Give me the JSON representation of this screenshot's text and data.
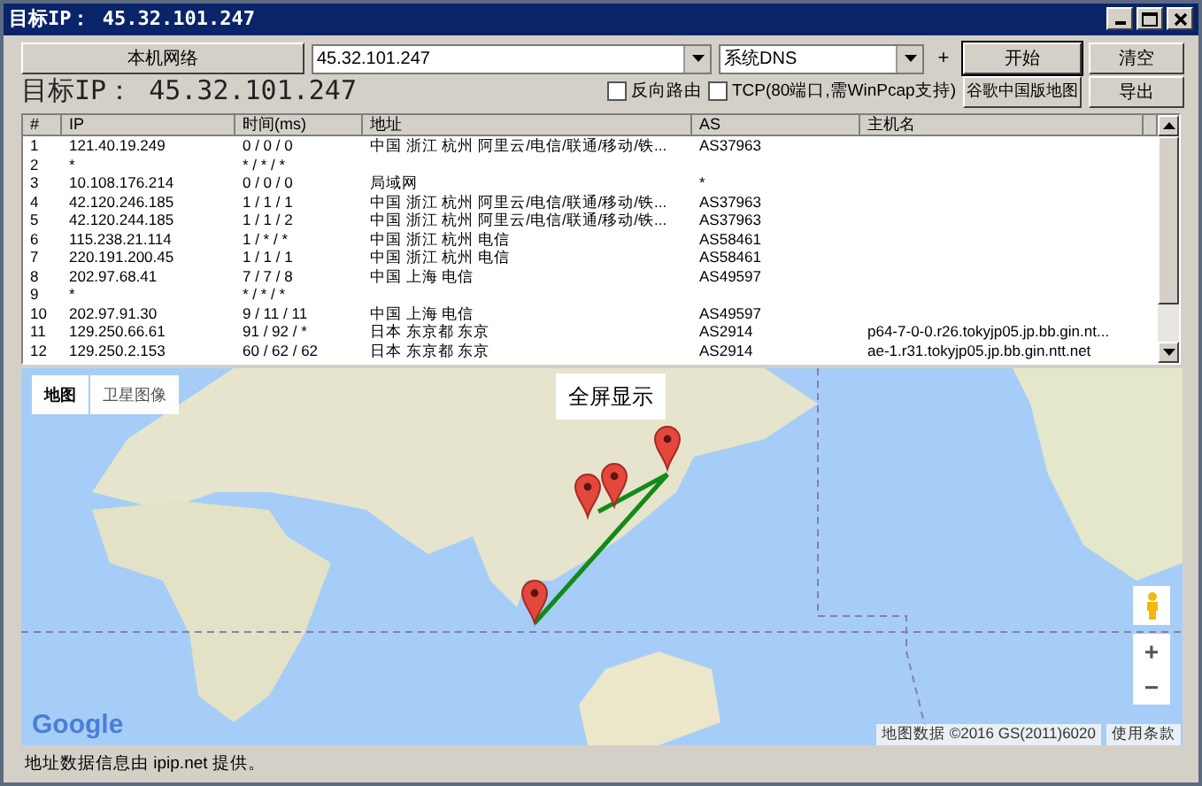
{
  "window": {
    "title": "目标IP： 45.32.101.247"
  },
  "toolbar": {
    "local_network_button": "本机网络",
    "target_combo": {
      "value": "45.32.101.247"
    },
    "dns_combo": {
      "value": "系统DNS"
    },
    "add_button": "+",
    "start_button": "开始",
    "clear_button": "清空"
  },
  "target_label": "目标IP： 45.32.101.247",
  "options": [
    {
      "label": "反向路由",
      "checked": false
    },
    {
      "label": "TCP(80端口,需WinPcap支持)",
      "checked": false
    }
  ],
  "map_button": "谷歌中国版地图",
  "export_button": "导出",
  "table": {
    "columns": [
      "#",
      "IP",
      "时间(ms)",
      "地址",
      "AS",
      "主机名"
    ],
    "rows": [
      [
        "1",
        "121.40.19.249",
        "0 / 0 / 0",
        "中国 浙江 杭州 阿里云/电信/联通/移动/铁...",
        "AS37963",
        ""
      ],
      [
        "2",
        "*",
        "* / * / *",
        "",
        "",
        ""
      ],
      [
        "3",
        "10.108.176.214",
        "0 / 0 / 0",
        "局域网",
        "*",
        ""
      ],
      [
        "4",
        "42.120.246.185",
        "1 / 1 / 1",
        "中国 浙江 杭州 阿里云/电信/联通/移动/铁...",
        "AS37963",
        ""
      ],
      [
        "5",
        "42.120.244.185",
        "1 / 1 / 2",
        "中国 浙江 杭州 阿里云/电信/联通/移动/铁...",
        "AS37963",
        ""
      ],
      [
        "6",
        "115.238.21.114",
        "1 / * / *",
        "中国 浙江 杭州 电信",
        "AS58461",
        ""
      ],
      [
        "7",
        "220.191.200.45",
        "1 / 1 / 1",
        "中国 浙江 杭州 电信",
        "AS58461",
        ""
      ],
      [
        "8",
        "202.97.68.41",
        "7 / 7 / 8",
        "中国 上海 电信",
        "AS49597",
        ""
      ],
      [
        "9",
        "*",
        "* / * / *",
        "",
        "",
        ""
      ],
      [
        "10",
        "202.97.91.30",
        "9 / 11 / 11",
        "中国 上海 电信",
        "AS49597",
        ""
      ],
      [
        "11",
        "129.250.66.61",
        "91 / 92 / *",
        "日本 东京都 东京",
        "AS2914",
        "p64-7-0-0.r26.tokyjp05.jp.bb.gin.nt..."
      ],
      [
        "12",
        "129.250.2.153",
        "60 / 62 / 62",
        "日本 东京都 东京",
        "AS2914",
        "ae-1.r31.tokyjp05.jp.bb.gin.ntt.net"
      ]
    ]
  },
  "map": {
    "map_types": [
      {
        "label": "地图",
        "selected": true
      },
      {
        "label": "卫星图像",
        "selected": false
      }
    ],
    "fullscreen_button": "全屏显示",
    "logo": "Google",
    "attribution": "地图数据 ©2016 GS(2011)6020",
    "terms_link": "使用条款",
    "zoom_in": "+",
    "zoom_out": "−"
  },
  "status_bar": "地址数据信息由 ipip.net 提供。"
}
